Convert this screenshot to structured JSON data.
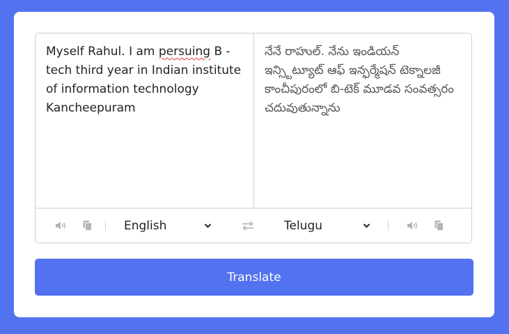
{
  "source": {
    "text_before": "Myself Rahul. I am ",
    "misspelled": "persuing",
    "text_after": " B -tech third year in Indian institute of information technology Kancheepuram"
  },
  "target": {
    "text": "నేనే రాహుల్. నేను ఇండియన్ ఇన్స్టిట్యూట్ ఆఫ్ ఇన్ఫర్మేషన్ టెక్నాలజీ కాంచీపురంలో బి-టెక్ మూడవ సంవత్సరం చదువుతున్నాను"
  },
  "controls": {
    "from_language": "English",
    "to_language": "Telugu",
    "icons": [
      "volume-icon",
      "copy-icon",
      "exchange-icon",
      "volume-icon",
      "copy-icon",
      "chevron-down-icon"
    ]
  },
  "translate_label": "Translate",
  "colors": {
    "accent": "#5372f0",
    "border": "#cfcfcf",
    "icon": "#b5b5b5"
  }
}
